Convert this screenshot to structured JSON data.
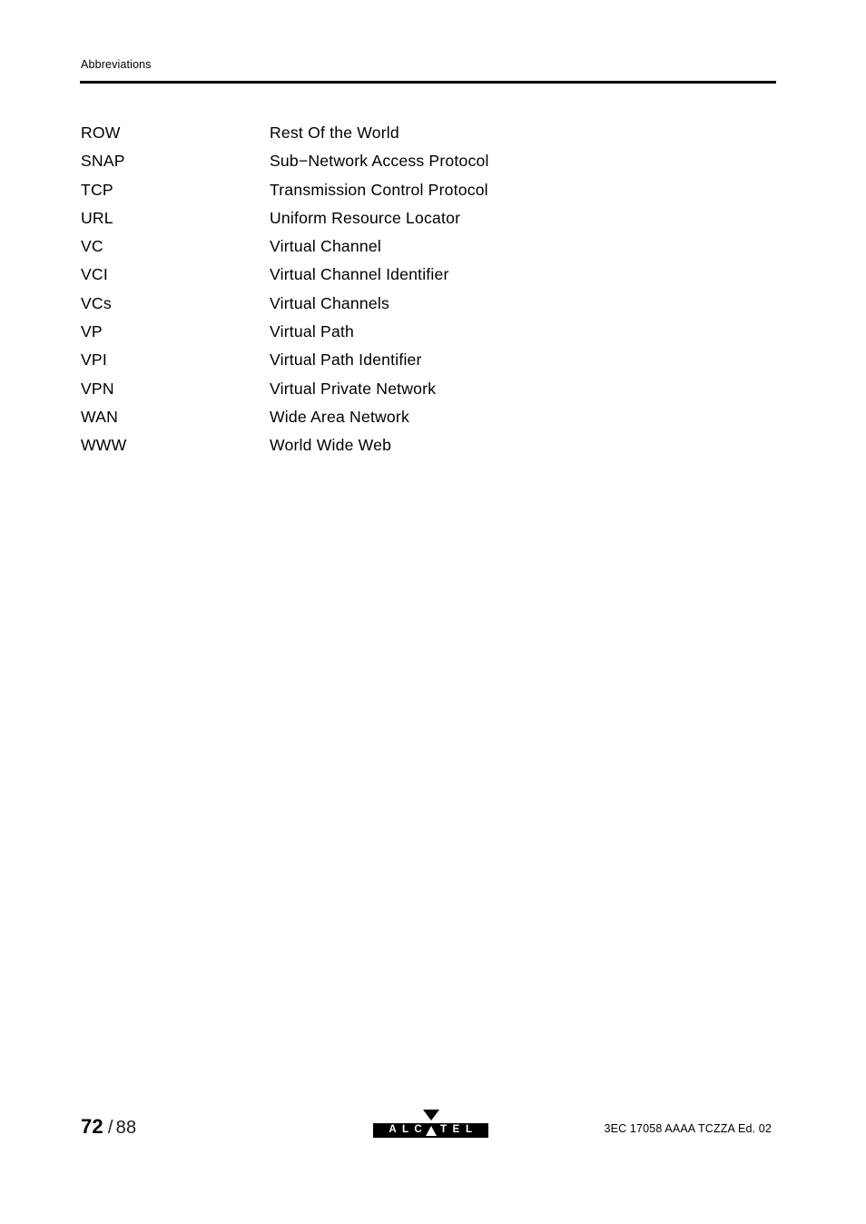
{
  "document": {
    "running_head": "Abbreviations"
  },
  "abbreviations": [
    {
      "term": "ROW",
      "definition": "Rest Of the World"
    },
    {
      "term": "SNAP",
      "definition": "Sub−Network Access Protocol"
    },
    {
      "term": "TCP",
      "definition": "Transmission Control Protocol"
    },
    {
      "term": "URL",
      "definition": "Uniform Resource Locator"
    },
    {
      "term": "VC",
      "definition": "Virtual Channel"
    },
    {
      "term": "VCI",
      "definition": "Virtual Channel Identifier"
    },
    {
      "term": "VCs",
      "definition": "Virtual Channels"
    },
    {
      "term": "VP",
      "definition": "Virtual Path"
    },
    {
      "term": "VPI",
      "definition": "Virtual Path Identifier"
    },
    {
      "term": "VPN",
      "definition": "Virtual Private Network"
    },
    {
      "term": "WAN",
      "definition": "Wide Area Network"
    },
    {
      "term": "WWW",
      "definition": "World Wide Web"
    }
  ],
  "footer": {
    "page_current": "72",
    "page_separator": "/",
    "page_total": "88",
    "logo": {
      "name": "alcatel-logo",
      "letters": [
        "A",
        "L",
        "C",
        "▲",
        "T",
        "E",
        "L"
      ],
      "wordmark": "ALCATEL",
      "triangle_glyph": "▼",
      "background_color": "#000000",
      "text_color": "#ffffff"
    },
    "doc_reference": "3EC 17058 AAAA TCZZA Ed. 02"
  }
}
